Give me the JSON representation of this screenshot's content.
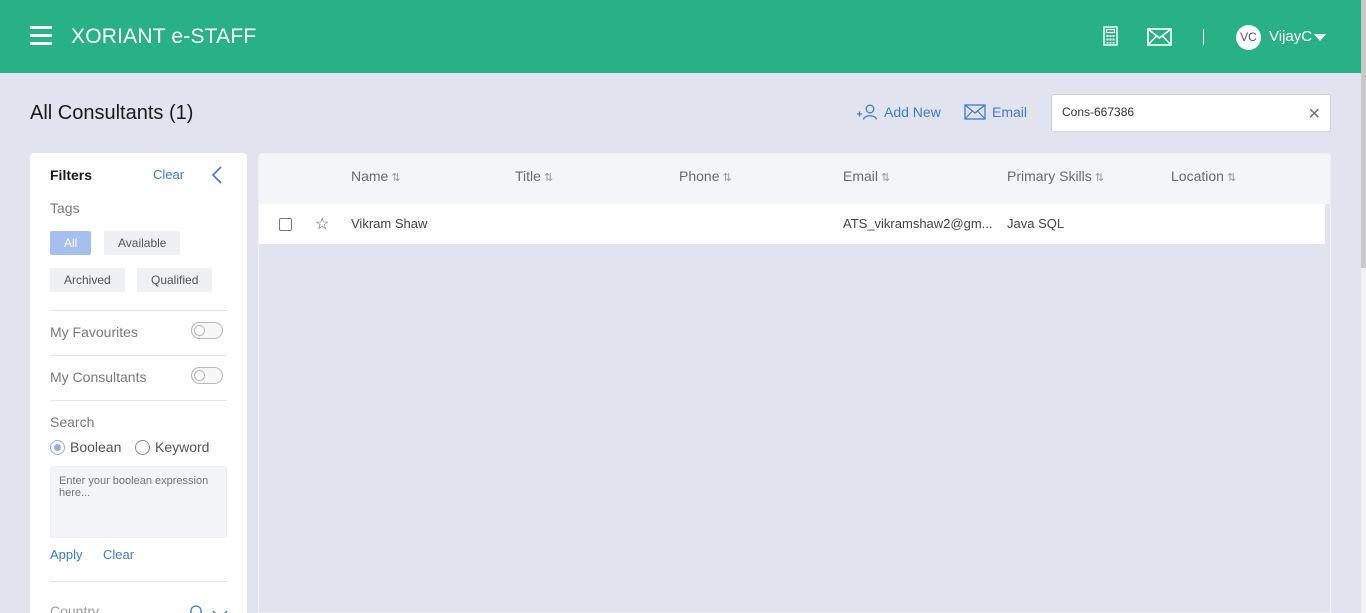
{
  "header": {
    "brand": "XORIANT e-STAFF",
    "avatar_initials": "VC",
    "username": "VijayC",
    "icons": [
      "hamburger-menu-icon",
      "calculator-icon",
      "mail-icon",
      "caret-down-icon"
    ],
    "bg_color": "#28b185"
  },
  "page": {
    "title": "All Consultants (1)",
    "add_new_label": "Add New",
    "email_label": "Email",
    "search_value": "Cons-667386"
  },
  "filters": {
    "title": "Filters",
    "clear_label": "Clear",
    "tags_label": "Tags",
    "tags": [
      "All",
      "Available",
      "Archived",
      "Qualified"
    ],
    "active_tag": "All",
    "my_favourites_label": "My Favourites",
    "my_consultants_label": "My Consultants",
    "search_label": "Search",
    "radio_boolean": "Boolean",
    "radio_keyword": "Keyword",
    "boolean_placeholder": "Enter your boolean expression here...",
    "apply_label": "Apply",
    "clear_bottom_label": "Clear",
    "country_label": "Country"
  },
  "table": {
    "columns": [
      "Name",
      "Title",
      "Phone",
      "Email",
      "Primary Skills",
      "Location"
    ],
    "sort_icon": "⇅",
    "rows": [
      {
        "name": "Vikram Shaw",
        "title": "",
        "phone": "",
        "email": "ATS_vikramshaw2@gm...",
        "skills": "Java SQL",
        "location": ""
      }
    ]
  },
  "colors": {
    "accent": "#3d7bd1",
    "active_tag": "#a5c0ee",
    "page_bg": "#e1e4ee"
  }
}
